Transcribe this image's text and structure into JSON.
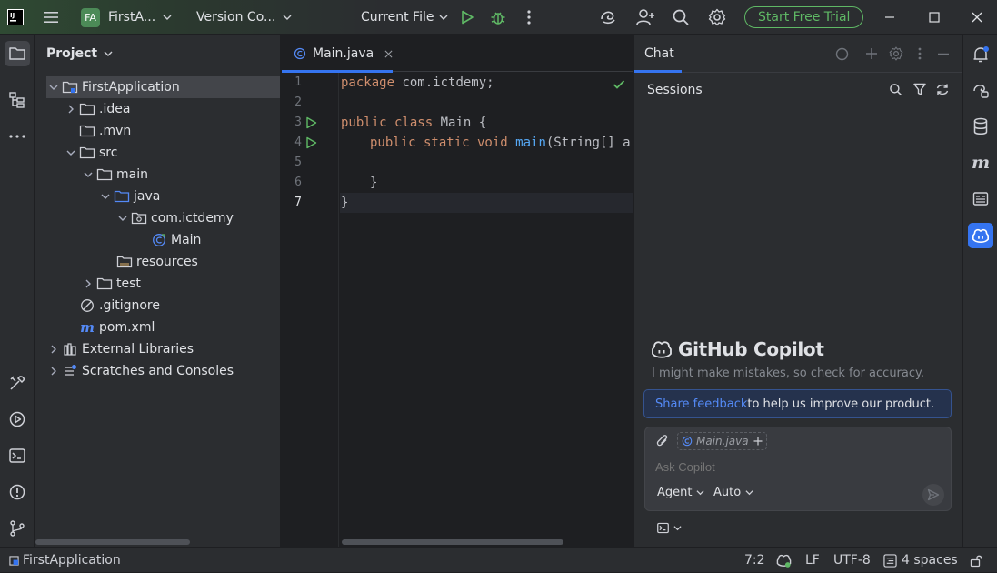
{
  "titlebar": {
    "project_badge": "FA",
    "project_name": "FirstA...",
    "vcs_label": "Version Co...",
    "run_config": "Current File",
    "trial_button": "Start Free Trial"
  },
  "project_panel": {
    "title": "Project",
    "tree": [
      {
        "label": "FirstApplication",
        "icon": "module-folder-icon"
      },
      {
        "label": ".idea",
        "icon": "folder-icon"
      },
      {
        "label": ".mvn",
        "icon": "folder-icon"
      },
      {
        "label": "src",
        "icon": "folder-icon"
      },
      {
        "label": "main",
        "icon": "folder-icon"
      },
      {
        "label": "java",
        "icon": "source-folder-icon"
      },
      {
        "label": "com.ictdemy",
        "icon": "package-icon"
      },
      {
        "label": "Main",
        "icon": "java-class-icon"
      },
      {
        "label": "resources",
        "icon": "resources-folder-icon"
      },
      {
        "label": "test",
        "icon": "folder-icon"
      },
      {
        "label": ".gitignore",
        "icon": "gitignore-icon"
      },
      {
        "label": "pom.xml",
        "icon": "maven-icon"
      },
      {
        "label": "External Libraries",
        "icon": "libraries-icon"
      },
      {
        "label": "Scratches and Consoles",
        "icon": "scratches-icon"
      }
    ]
  },
  "editor": {
    "tab_label": "Main.java",
    "line_numbers": [
      "1",
      "2",
      "3",
      "4",
      "5",
      "6",
      "7"
    ],
    "code": {
      "l1_kw": "package",
      "l1_rest": " com.ictdemy;",
      "l3_kw": "public class",
      "l3_rest": " Main {",
      "l4_kw": "public static void",
      "l4_fn": "main",
      "l4_rest": "(String[] arg",
      "l6": "}",
      "l7": "}"
    }
  },
  "chat": {
    "tab_label": "Chat",
    "sessions_label": "Sessions",
    "brand_title": "GitHub Copilot",
    "disclaimer": "I might make mistakes, so check for accuracy.",
    "feedback_link": "Share feedback",
    "feedback_rest": " to help us improve our product.",
    "context_file": "Main.java",
    "input_placeholder": "Ask Copilot",
    "mode_label": "Agent",
    "model_label": "Auto"
  },
  "statusbar": {
    "project_name": "FirstApplication",
    "cursor_position": "7:2",
    "line_separator": "LF",
    "encoding": "UTF-8",
    "indent": "4 spaces"
  },
  "colors": {
    "accent": "#3574f0",
    "trial_green": "#5fb865",
    "run_green": "#5fb865",
    "keyword": "#cf8e6d",
    "function": "#56a8f5"
  }
}
